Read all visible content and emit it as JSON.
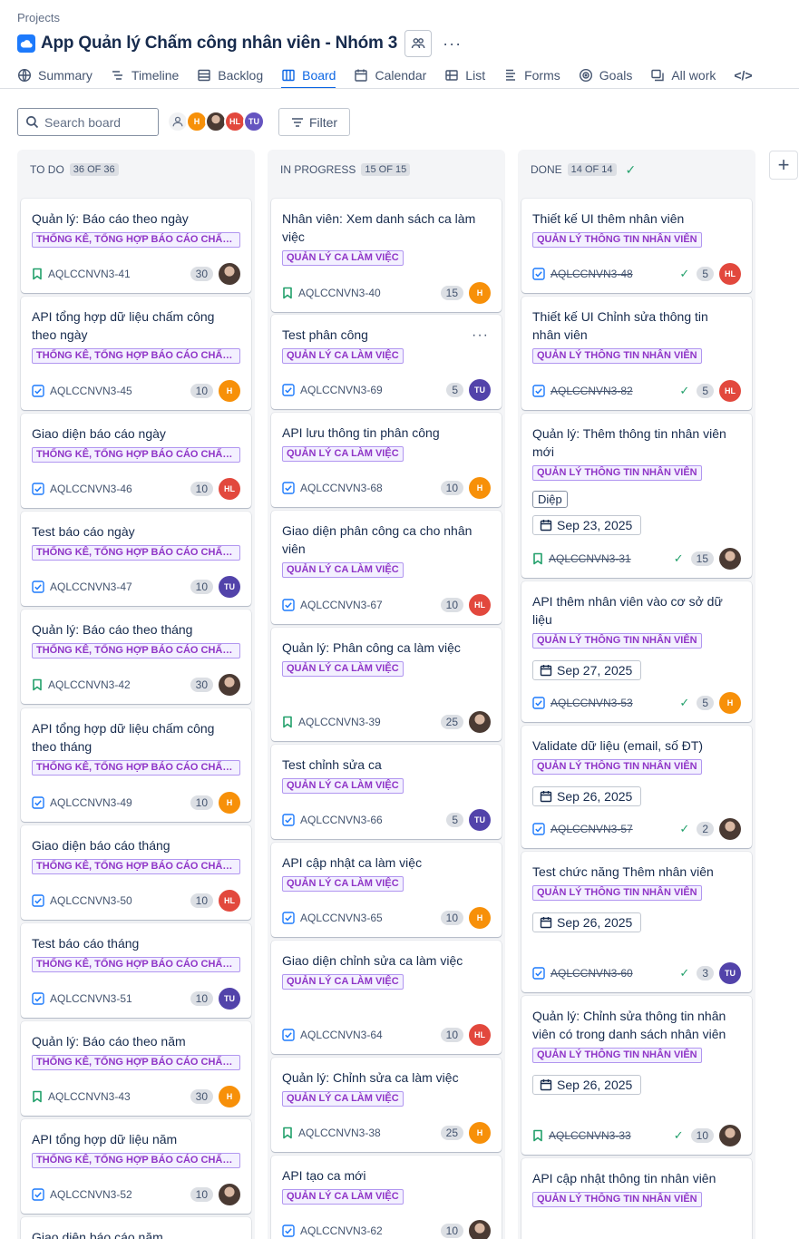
{
  "header": {
    "breadcrumb": "Projects",
    "title": "App Quản lý Chấm công nhân viên - Nhóm 3",
    "more": "···"
  },
  "tabs": [
    {
      "label": "Summary",
      "icon": "globe-icon"
    },
    {
      "label": "Timeline",
      "icon": "timeline-icon"
    },
    {
      "label": "Backlog",
      "icon": "backlog-icon"
    },
    {
      "label": "Board",
      "icon": "board-icon",
      "active": true
    },
    {
      "label": "Calendar",
      "icon": "calendar-icon"
    },
    {
      "label": "List",
      "icon": "list-icon"
    },
    {
      "label": "Forms",
      "icon": "forms-icon"
    },
    {
      "label": "Goals",
      "icon": "goals-icon"
    },
    {
      "label": "All work",
      "icon": "all-work-icon"
    }
  ],
  "toolbar": {
    "search_placeholder": "Search board",
    "filter_label": "Filter",
    "avatars": [
      {
        "initials": "",
        "color": "#ffffff",
        "kind": "unassigned"
      },
      {
        "initials": "H",
        "color": "#f79009"
      },
      {
        "initials": "",
        "color": "#6b5b55",
        "kind": "photo"
      },
      {
        "initials": "HL",
        "color": "#e2483d"
      },
      {
        "initials": "TU",
        "color": "#6554c0"
      }
    ]
  },
  "colors": {
    "accent": "#0c66e4",
    "label_purple": "#8f35c7",
    "done_green": "#22a06b"
  },
  "assignees": {
    "H": {
      "initials": "H",
      "color": "#f79009"
    },
    "HL": {
      "initials": "HL",
      "color": "#e2483d"
    },
    "TU": {
      "initials": "TU",
      "color": "#5243aa"
    },
    "P": {
      "initials": "",
      "color": "#6b5b55"
    }
  },
  "columns": [
    {
      "name": "TO DO",
      "count": "36 OF 36",
      "done": false,
      "cards": [
        {
          "title": "Quản lý: Báo cáo theo ngày",
          "label": "THỐNG KÊ, TỔNG HỢP BÁO CÁO CHẤM CÔNG",
          "type": "story",
          "key": "AQLCCNVN3-41",
          "points": "30",
          "assignee": "P"
        },
        {
          "title": "API tổng hợp dữ liệu chấm công theo ngày",
          "label": "THỐNG KÊ, TỔNG HỢP BÁO CÁO CHẤM CÔNG",
          "type": "task",
          "key": "AQLCCNVN3-45",
          "points": "10",
          "assignee": "H"
        },
        {
          "title": "Giao diện báo cáo ngày",
          "label": "THỐNG KÊ, TỔNG HỢP BÁO CÁO CHẤM CÔNG",
          "type": "task",
          "key": "AQLCCNVN3-46",
          "points": "10",
          "assignee": "HL"
        },
        {
          "title": "Test báo cáo ngày",
          "label": "THỐNG KÊ, TỔNG HỢP BÁO CÁO CHẤM CÔNG",
          "type": "task",
          "key": "AQLCCNVN3-47",
          "points": "10",
          "assignee": "TU"
        },
        {
          "title": "Quản lý: Báo cáo theo tháng",
          "label": "THỐNG KÊ, TỔNG HỢP BÁO CÁO CHẤM CÔNG",
          "type": "story",
          "key": "AQLCCNVN3-42",
          "points": "30",
          "assignee": "P"
        },
        {
          "title": "API tổng hợp dữ liệu chấm công theo tháng",
          "label": "THỐNG KÊ, TỔNG HỢP BÁO CÁO CHẤM CÔNG",
          "type": "task",
          "key": "AQLCCNVN3-49",
          "points": "10",
          "assignee": "H"
        },
        {
          "title": "Giao diện báo cáo tháng",
          "label": "THỐNG KÊ, TỔNG HỢP BÁO CÁO CHẤM CÔNG",
          "type": "task",
          "key": "AQLCCNVN3-50",
          "points": "10",
          "assignee": "HL"
        },
        {
          "title": "Test báo cáo tháng",
          "label": "THỐNG KÊ, TỔNG HỢP BÁO CÁO CHẤM CÔNG",
          "type": "task",
          "key": "AQLCCNVN3-51",
          "points": "10",
          "assignee": "TU"
        },
        {
          "title": "Quản lý: Báo cáo theo năm",
          "label": "THỐNG KÊ, TỔNG HỢP BÁO CÁO CHẤM CÔNG",
          "type": "story",
          "key": "AQLCCNVN3-43",
          "points": "30",
          "assignee": "H"
        },
        {
          "title": "API tổng hợp dữ liệu năm",
          "label": "THỐNG KÊ, TỔNG HỢP BÁO CÁO CHẤM CÔNG",
          "type": "task",
          "key": "AQLCCNVN3-52",
          "points": "10",
          "assignee": "P"
        },
        {
          "title": "Giao diện báo cáo năm",
          "label": "",
          "type": "",
          "key": "",
          "points": "",
          "assignee": ""
        }
      ]
    },
    {
      "name": "IN PROGRESS",
      "count": "15 OF 15",
      "done": false,
      "cards": [
        {
          "title": "Nhân viên: Xem danh sách ca làm việc",
          "label": "QUẢN LÝ CA LÀM VIỆC",
          "type": "story",
          "key": "AQLCCNVN3-40",
          "points": "15",
          "assignee": "H"
        },
        {
          "title": "Test phân công",
          "label": "QUẢN LÝ CA LÀM VIỆC",
          "type": "task",
          "key": "AQLCCNVN3-69",
          "points": "5",
          "assignee": "TU",
          "more": "···"
        },
        {
          "title": "API lưu thông tin phân công",
          "label": "QUẢN LÝ CA LÀM VIỆC",
          "type": "task",
          "key": "AQLCCNVN3-68",
          "points": "10",
          "assignee": "H"
        },
        {
          "title": "Giao diện phân công ca cho nhân viên",
          "label": "QUẢN LÝ CA LÀM VIỆC",
          "type": "task",
          "key": "AQLCCNVN3-67",
          "points": "10",
          "assignee": "HL"
        },
        {
          "title": "Quản lý: Phân công ca làm việc",
          "label": "QUẢN LÝ CA LÀM VIỆC",
          "type": "story",
          "key": "AQLCCNVN3-39",
          "points": "25",
          "assignee": "P"
        },
        {
          "title": "Test chỉnh sửa ca",
          "label": "QUẢN LÝ CA LÀM VIỆC",
          "type": "task",
          "key": "AQLCCNVN3-66",
          "points": "5",
          "assignee": "TU"
        },
        {
          "title": "API cập nhật ca làm việc",
          "label": "QUẢN LÝ CA LÀM VIỆC",
          "type": "task",
          "key": "AQLCCNVN3-65",
          "points": "10",
          "assignee": "H"
        },
        {
          "title": "Giao diện chỉnh sửa ca làm việc",
          "label": "QUẢN LÝ CA LÀM VIỆC",
          "type": "task",
          "key": "AQLCCNVN3-64",
          "points": "10",
          "assignee": "HL"
        },
        {
          "title": "Quản lý: Chỉnh sửa ca làm việc",
          "label": "QUẢN LÝ CA LÀM VIỆC",
          "type": "story",
          "key": "AQLCCNVN3-38",
          "points": "25",
          "assignee": "H"
        },
        {
          "title": "API tạo ca mới",
          "label": "QUẢN LÝ CA LÀM VIỆC",
          "type": "task",
          "key": "AQLCCNVN3-62",
          "points": "10",
          "assignee": "P"
        }
      ]
    },
    {
      "name": "DONE",
      "count": "14 OF 14",
      "done": true,
      "cards": [
        {
          "title": "Thiết kế UI thêm nhân viên",
          "label": "QUẢN LÝ THÔNG TIN NHÂN VIÊN",
          "type": "task",
          "key": "AQLCCNVN3-48",
          "points": "5",
          "assignee": "HL"
        },
        {
          "title": "Thiết kế UI Chỉnh sửa thông tin nhân viên",
          "label": "QUẢN LÝ THÔNG TIN NHÂN VIÊN",
          "type": "task",
          "key": "AQLCCNVN3-82",
          "points": "5",
          "assignee": "HL"
        },
        {
          "title": "Quản lý: Thêm thông tin nhân viên mới",
          "label": "QUẢN LÝ THÔNG TIN NHÂN VIÊN",
          "tag": "Diệp",
          "date": "Sep 23, 2025",
          "type": "story",
          "key": "AQLCCNVN3-31",
          "points": "15",
          "assignee": "P"
        },
        {
          "title": "API thêm nhân viên vào cơ sở dữ liệu",
          "label": "QUẢN LÝ THÔNG TIN NHÂN VIÊN",
          "date": "Sep 27, 2025",
          "type": "task",
          "key": "AQLCCNVN3-53",
          "points": "5",
          "assignee": "H"
        },
        {
          "title": "Validate dữ liệu (email, số ĐT)",
          "label": "QUẢN LÝ THÔNG TIN NHÂN VIÊN",
          "date": "Sep 26, 2025",
          "type": "task",
          "key": "AQLCCNVN3-57",
          "points": "2",
          "assignee": "P"
        },
        {
          "title": "Test chức năng Thêm nhân viên",
          "label": "QUẢN LÝ THÔNG TIN NHÂN VIÊN",
          "date": "Sep 26, 2025",
          "type": "task",
          "key": "AQLCCNVN3-60",
          "points": "3",
          "assignee": "TU"
        },
        {
          "title": "Quản lý: Chỉnh sửa thông tin nhân viên có trong danh sách nhân viên",
          "label": "QUẢN LÝ THÔNG TIN NHÂN VIÊN",
          "date": "Sep 26, 2025",
          "type": "story",
          "key": "AQLCCNVN3-33",
          "points": "10",
          "assignee": "P"
        },
        {
          "title": "API cập nhật thông tin nhân viên",
          "label": "QUẢN LÝ THÔNG TIN NHÂN VIÊN",
          "type": "",
          "key": "",
          "points": "",
          "assignee": ""
        }
      ]
    }
  ]
}
